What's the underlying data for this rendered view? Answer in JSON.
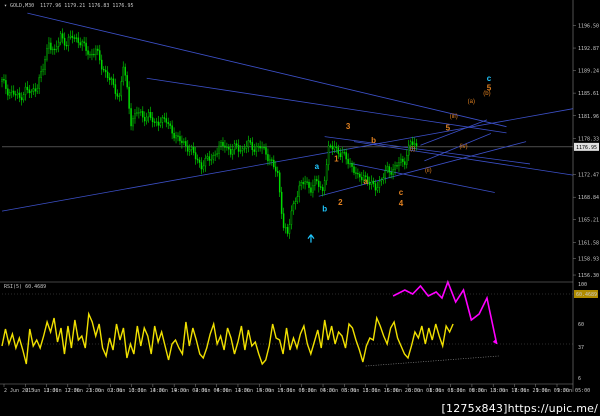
{
  "header": {
    "symbol": "GOLD,M30",
    "ohlc": "1177.96 1179.21 1176.83 1176.95",
    "rsi_label": "RSI(5) 60.4689"
  },
  "watermark": "[1275x843]https://upic.me/",
  "colors": {
    "background": "#000000",
    "candle": "#00e000",
    "trendline": "#3c50c8",
    "rsi": "#f0e000",
    "projection": "#ff00ff",
    "grid_dots": "#5a5a5a",
    "wave_orange": "#e08020",
    "wave_cyan": "#20c8ff",
    "current_price_label": "#e0e0e0",
    "rsi_level_label": "#b08c00"
  },
  "chart_data": [
    {
      "type": "candlestick",
      "instrument": "GOLD",
      "timeframe": "M30",
      "price_axis_ticks": [
        1196.5,
        1192.87,
        1189.24,
        1185.61,
        1181.96,
        1178.33,
        1172.47,
        1168.84,
        1165.21,
        1161.58,
        1158.93,
        1156.3
      ],
      "current_price": 1176.95,
      "ylim": [
        1155.5,
        1199.0
      ],
      "time_axis_labels": [
        "2 Jun 2015",
        "2 Jun 13:00",
        "2 Jun 17:00",
        "2 Jun 21:00",
        "3 Jun 02:00",
        "3 Jun 10:00",
        "3 Jun 14:00",
        "3 Jun 19:00",
        "4 Jun 02:00",
        "4 Jun 06:00",
        "4 Jun 11:00",
        "4 Jun 15:00",
        "4 Jun 19:00",
        "5 Jun 00:00",
        "5 Jun 04:00",
        "5 Jun 08:00",
        "5 Jun 12:00",
        "5 Jun 16:00",
        "5 Jun 20:00",
        "8 Jun 01:00",
        "8 Jun 05:00",
        "8 Jun 09:00",
        "8 Jun 13:00",
        "8 Jun 17:00",
        "8 Jun 21:00",
        "9 Jun 01:00",
        "9 Jun 05:00"
      ],
      "close_path": [
        [
          0,
          1187.5
        ],
        [
          3,
          1186.0
        ],
        [
          6,
          1185.5
        ],
        [
          9,
          1184.8
        ],
        [
          12,
          1186.2
        ],
        [
          15,
          1185.5
        ],
        [
          18,
          1187.0
        ],
        [
          21,
          1189.5
        ],
        [
          24,
          1194.0
        ],
        [
          27,
          1192.0
        ],
        [
          30,
          1195.0
        ],
        [
          33,
          1193.5
        ],
        [
          36,
          1194.8
        ],
        [
          39,
          1194.2
        ],
        [
          42,
          1193.0
        ],
        [
          45,
          1191.8
        ],
        [
          48,
          1192.5
        ],
        [
          51,
          1190.0
        ],
        [
          54,
          1188.4
        ],
        [
          57,
          1186.6
        ],
        [
          60,
          1185.0
        ],
        [
          62,
          1190.0
        ],
        [
          64,
          1186.0
        ],
        [
          66,
          1181.0
        ],
        [
          69,
          1182.6
        ],
        [
          72,
          1181.8
        ],
        [
          75,
          1182.1
        ],
        [
          78,
          1180.5
        ],
        [
          81,
          1181.4
        ],
        [
          84,
          1181.0
        ],
        [
          87,
          1179.6
        ],
        [
          90,
          1178.0
        ],
        [
          93,
          1177.6
        ],
        [
          96,
          1176.6
        ],
        [
          99,
          1175.3
        ],
        [
          102,
          1173.9
        ],
        [
          105,
          1174.8
        ],
        [
          108,
          1175.5
        ],
        [
          111,
          1176.7
        ],
        [
          114,
          1177.4
        ],
        [
          117,
          1176.1
        ],
        [
          120,
          1177.0
        ],
        [
          123,
          1176.5
        ],
        [
          126,
          1177.4
        ],
        [
          129,
          1176.8
        ],
        [
          132,
          1176.9
        ],
        [
          135,
          1176.0
        ],
        [
          138,
          1174.4
        ],
        [
          141,
          1172.3
        ],
        [
          144,
          1164.3
        ],
        [
          146,
          1162.7
        ],
        [
          148,
          1166.4
        ],
        [
          150,
          1168.7
        ],
        [
          152,
          1170.3
        ],
        [
          155,
          1171.4
        ],
        [
          158,
          1170.3
        ],
        [
          161,
          1171.3
        ],
        [
          164,
          1169.9
        ],
        [
          167,
          1176.4
        ],
        [
          170,
          1177.2
        ],
        [
          173,
          1175.7
        ],
        [
          176,
          1175.2
        ],
        [
          179,
          1173.8
        ],
        [
          182,
          1171.8
        ],
        [
          185,
          1172.5
        ],
        [
          188,
          1170.9
        ],
        [
          191,
          1170.6
        ],
        [
          194,
          1171.5
        ],
        [
          197,
          1173.3
        ],
        [
          200,
          1173.2
        ],
        [
          203,
          1174.3
        ],
        [
          206,
          1174.9
        ],
        [
          209,
          1177.6
        ],
        [
          212,
          1177.0
        ]
      ],
      "trendlines": [
        {
          "from": [
            13,
            1198.5
          ],
          "to": [
            258,
            1180.2
          ]
        },
        {
          "from": [
            74,
            1188.0
          ],
          "to": [
            258,
            1179.2
          ]
        },
        {
          "from": [
            0,
            1166.6
          ],
          "to": [
            292,
            1183.1
          ]
        },
        {
          "from": [
            180,
            1177.8
          ],
          "to": [
            292,
            1172.4
          ]
        },
        {
          "from": [
            178,
            1174.3
          ],
          "to": [
            252,
            1169.6
          ]
        },
        {
          "from": [
            165,
            1178.6
          ],
          "to": [
            270,
            1174.2
          ]
        },
        {
          "from": [
            162,
            1169.0
          ],
          "to": [
            268,
            1177.8
          ]
        },
        {
          "from": [
            214,
            1177.2
          ],
          "to": [
            248,
            1181.3
          ]
        },
        {
          "from": [
            216,
            1174.7
          ],
          "to": [
            250,
            1179.1
          ]
        }
      ],
      "current_price_line": 1176.95,
      "wave_labels": [
        {
          "text": "3",
          "x": 177,
          "y": 1179.8,
          "color": "#e08020"
        },
        {
          "text": "1",
          "x": 171,
          "y": 1174.6,
          "color": "#e08020"
        },
        {
          "text": "2",
          "x": 173,
          "y": 1167.6,
          "color": "#e08020"
        },
        {
          "text": "4",
          "x": 204,
          "y": 1167.4,
          "color": "#e08020"
        },
        {
          "text": "5",
          "x": 228,
          "y": 1179.6,
          "color": "#e08020"
        },
        {
          "text": "b",
          "x": 190,
          "y": 1177.6,
          "color": "#e08020"
        },
        {
          "text": "a",
          "x": 186,
          "y": 1171.0,
          "color": "#e08020"
        },
        {
          "text": "c",
          "x": 204,
          "y": 1169.2,
          "color": "#e08020"
        },
        {
          "text": "(i)",
          "x": 210,
          "y": 1176.4,
          "color": "#e08020"
        },
        {
          "text": "(ii)",
          "x": 218,
          "y": 1172.9,
          "color": "#e08020"
        },
        {
          "text": "(iii)",
          "x": 231,
          "y": 1181.6,
          "color": "#e08020"
        },
        {
          "text": "(iv)",
          "x": 236,
          "y": 1176.8,
          "color": "#e08020"
        },
        {
          "text": "(a)",
          "x": 240,
          "y": 1184.0,
          "color": "#e08020"
        },
        {
          "text": "(b)",
          "x": 248,
          "y": 1185.3,
          "color": "#e08020"
        },
        {
          "text": "a",
          "x": 161,
          "y": 1173.4,
          "color": "#20c8ff"
        },
        {
          "text": "b",
          "x": 165,
          "y": 1166.5,
          "color": "#20c8ff"
        },
        {
          "text": "c",
          "x": 249,
          "y": 1187.6,
          "color": "#20c8ff"
        },
        {
          "text": "5",
          "x": 249,
          "y": 1186.0,
          "color": "#e08020"
        }
      ],
      "arrows": [
        {
          "x": 158,
          "y": 1162.0,
          "direction": "up",
          "color": "#20c8ff"
        }
      ]
    },
    {
      "type": "line",
      "name": "RSI(5) 60.4689",
      "value": 60.4689,
      "ylim": [
        0,
        100
      ],
      "levels": [
        90,
        40
      ],
      "axis_ticks": [
        100,
        60,
        37,
        6
      ],
      "level_labels": [
        "60.4689",
        "37"
      ],
      "x_range": [
        0,
        292
      ],
      "values": [
        38,
        55,
        40,
        50,
        36,
        46,
        34,
        20,
        55,
        38,
        44,
        36,
        48,
        62,
        52,
        66,
        42,
        56,
        30,
        58,
        36,
        64,
        44,
        48,
        36,
        70,
        62,
        48,
        60,
        36,
        28,
        46,
        34,
        60,
        44,
        56,
        26,
        40,
        30,
        58,
        38,
        56,
        48,
        30,
        58,
        42,
        52,
        38,
        24,
        40,
        44,
        36,
        30,
        62,
        38,
        56,
        44,
        30,
        26,
        36,
        50,
        60,
        40,
        48,
        34,
        56,
        46,
        30,
        42,
        58,
        34,
        54,
        38,
        42,
        30,
        20,
        24,
        38,
        60,
        46,
        44,
        30,
        56,
        34,
        46,
        36,
        50,
        58,
        40,
        30,
        42,
        54,
        36,
        64,
        44,
        58,
        40,
        52,
        48,
        36,
        60,
        56,
        44,
        34,
        22,
        38,
        46,
        44,
        66,
        58,
        48,
        40,
        56,
        62,
        46,
        38,
        30,
        26,
        38,
        52,
        46,
        58,
        40,
        56,
        44,
        60,
        48,
        38,
        58,
        52,
        60
      ],
      "projection": [
        [
          200,
          88
        ],
        [
          206,
          94
        ],
        [
          210,
          90
        ],
        [
          214,
          98
        ],
        [
          218,
          88
        ],
        [
          222,
          92
        ],
        [
          225,
          86
        ],
        [
          228,
          102
        ],
        [
          232,
          82
        ],
        [
          236,
          94
        ],
        [
          240,
          64
        ],
        [
          244,
          70
        ],
        [
          248,
          86
        ],
        [
          253,
          40
        ]
      ],
      "support_line": {
        "from": [
          186,
          18
        ],
        "to": [
          254,
          28
        ]
      }
    }
  ]
}
